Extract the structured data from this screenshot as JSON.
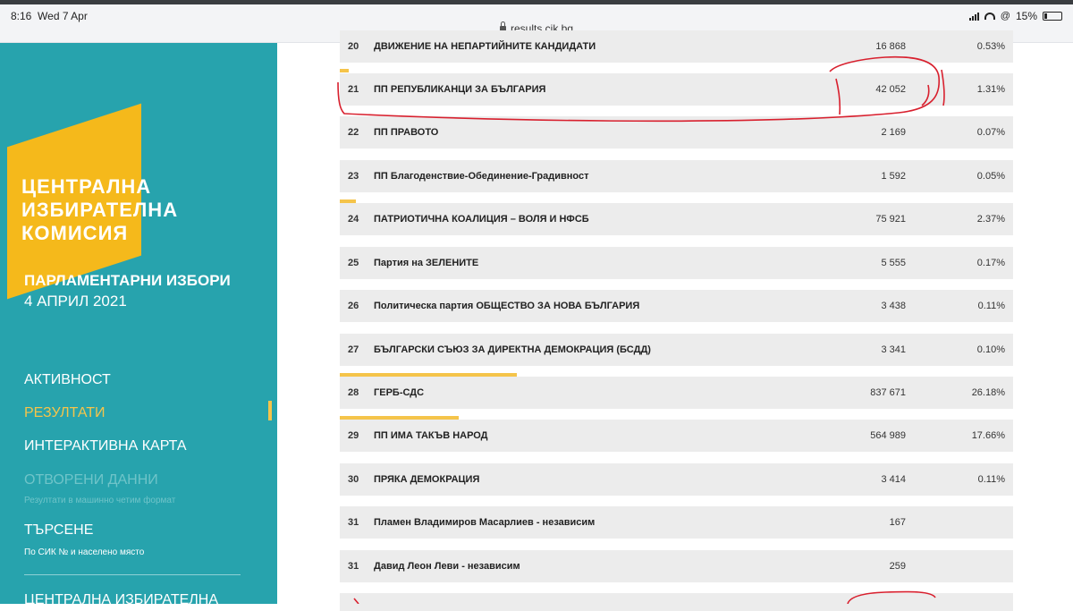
{
  "status_bar": {
    "time": "8:16",
    "date": "Wed 7 Apr",
    "url": "results.cik.bg",
    "battery": "15%"
  },
  "sidebar": {
    "logo_lines": [
      "ЦЕНТРАЛНА",
      "ИЗБИРАТЕЛНА",
      "КОМИСИЯ"
    ],
    "election_title": "ПАРЛАМЕНТАРНИ ИЗБОРИ",
    "election_date": "4 АПРИЛ 2021",
    "nav": {
      "activity": "АКТИВНОСТ",
      "results": "РЕЗУЛТАТИ",
      "interactive_map": "ИНТЕРАКТИВНА КАРТА",
      "open_data": "ОТВОРЕНИ ДАННИ",
      "open_data_sub": "Резултати в машинно четим формат",
      "search": "ТЪРСЕНЕ",
      "search_sub": "По СИК № и населено място",
      "cik": "ЦЕНТРАЛНА ИЗБИРАТЕЛНА"
    }
  },
  "results": {
    "rows": [
      {
        "num": "20",
        "name": "ДВИЖЕНИЕ НА НЕПАРТИЙНИТЕ КАНДИДАТИ",
        "votes": "16 868",
        "pct": "0.53%"
      },
      {
        "num": "21",
        "name": "ПП РЕПУБЛИКАНЦИ ЗА БЪЛГАРИЯ",
        "votes": "42 052",
        "pct": "1.31%"
      },
      {
        "num": "22",
        "name": "ПП ПРАВОТО",
        "votes": "2 169",
        "pct": "0.07%"
      },
      {
        "num": "23",
        "name": "ПП Благоденствие-Обединение-Градивност",
        "votes": "1 592",
        "pct": "0.05%"
      },
      {
        "num": "24",
        "name": "ПАТРИОТИЧНА КОАЛИЦИЯ – ВОЛЯ И НФСБ",
        "votes": "75 921",
        "pct": "2.37%"
      },
      {
        "num": "25",
        "name": "Партия на ЗЕЛЕНИТЕ",
        "votes": "5 555",
        "pct": "0.17%"
      },
      {
        "num": "26",
        "name": "Политическа партия  ОБЩЕСТВО ЗА НОВА БЪЛГАРИЯ",
        "votes": "3 438",
        "pct": "0.11%"
      },
      {
        "num": "27",
        "name": "БЪЛГАРСКИ СЪЮЗ ЗА ДИРЕКТНА ДЕМОКРАЦИЯ (БСДД)",
        "votes": "3 341",
        "pct": "0.10%"
      },
      {
        "num": "28",
        "name": "ГЕРБ-СДС",
        "votes": "837 671",
        "pct": "26.18%"
      },
      {
        "num": "29",
        "name": "ПП ИМА ТАКЪВ НАРОД",
        "votes": "564 989",
        "pct": "17.66%"
      },
      {
        "num": "30",
        "name": "ПРЯКА ДЕМОКРАЦИЯ",
        "votes": "3 414",
        "pct": "0.11%"
      },
      {
        "num": "31",
        "name": "Пламен Владимиров Масарлиев - независим",
        "votes": "167",
        "pct": ""
      },
      {
        "num": "31",
        "name": "Давид Леон Леви - независим",
        "votes": "259",
        "pct": ""
      }
    ]
  },
  "colors": {
    "sidebar": "#27a3ad",
    "accent": "#f5b91b",
    "row_bg": "#ececec",
    "annotation": "#d8202e"
  }
}
